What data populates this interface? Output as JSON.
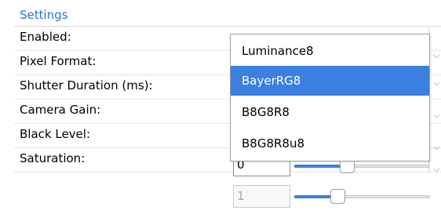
{
  "settings": {
    "title": "Settings",
    "rows": [
      {
        "label": "Enabled:"
      },
      {
        "label": "Pixel Format:"
      },
      {
        "label": "Shutter Duration (ms):"
      },
      {
        "label": "Camera Gain:"
      },
      {
        "label": "Black Level:"
      },
      {
        "label": "Saturation:"
      }
    ]
  },
  "pixel_format_dropdown": {
    "options": [
      "Luminance8",
      "BayerRG8",
      "B8G8R8",
      "B8G8R8u8"
    ],
    "highlighted": "BayerRG8"
  },
  "black_level": {
    "value": "0",
    "slider_fraction": 0.38
  },
  "saturation": {
    "value": "1",
    "slider_fraction": 0.3,
    "disabled": true
  },
  "colors": {
    "accent": "#3b7fe0",
    "header_text": "#2c72d4"
  },
  "icons": {
    "dropdown_arrow": "chevron-down-icon"
  }
}
